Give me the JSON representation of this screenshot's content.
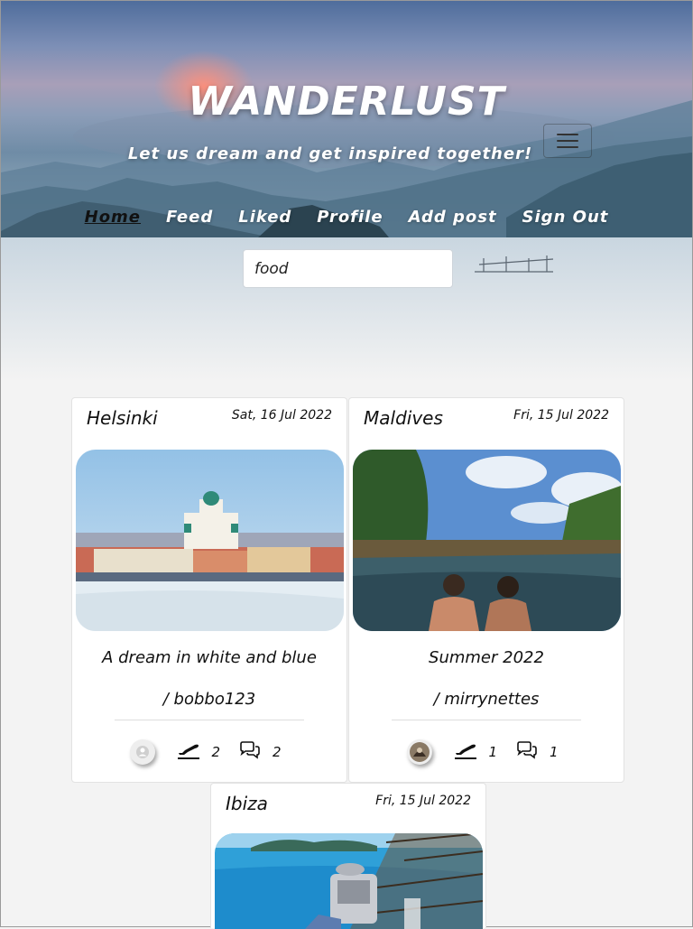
{
  "header": {
    "brand": "WANDERLUST",
    "tagline": "Let us dream and get inspired together!"
  },
  "nav": {
    "items": [
      {
        "label": "Home",
        "active": true
      },
      {
        "label": "Feed",
        "active": false
      },
      {
        "label": "Liked",
        "active": false
      },
      {
        "label": "Profile",
        "active": false
      },
      {
        "label": "Add post",
        "active": false
      },
      {
        "label": "Sign Out",
        "active": false
      }
    ]
  },
  "search": {
    "value": "food"
  },
  "posts": [
    {
      "title": "Helsinki",
      "date": "Sat, 16 Jul 2022",
      "caption": "A dream in white and blue",
      "author": "/ bobbo123",
      "likes": "2",
      "comments": "2",
      "photo": "helsinki-cathedral-harbor"
    },
    {
      "title": "Maldives",
      "date": "Fri, 15 Jul 2022",
      "caption": "Summer 2022",
      "author": "/ mirrynettes",
      "likes": "1",
      "comments": "1",
      "photo": "infinity-pool-palms"
    },
    {
      "title": "Ibiza",
      "date": "Fri, 15 Jul 2022",
      "photo": "sea-view-terrace"
    }
  ],
  "icons": {
    "menu": "hamburger-icon",
    "like": "plane-takeoff-icon",
    "comment": "comments-icon",
    "avatar_default": "user-icon"
  },
  "colors": {
    "text": "#111111",
    "nav_text": "#ffffff",
    "page_bg": "#f3f3f3",
    "card_bg": "#ffffff"
  }
}
